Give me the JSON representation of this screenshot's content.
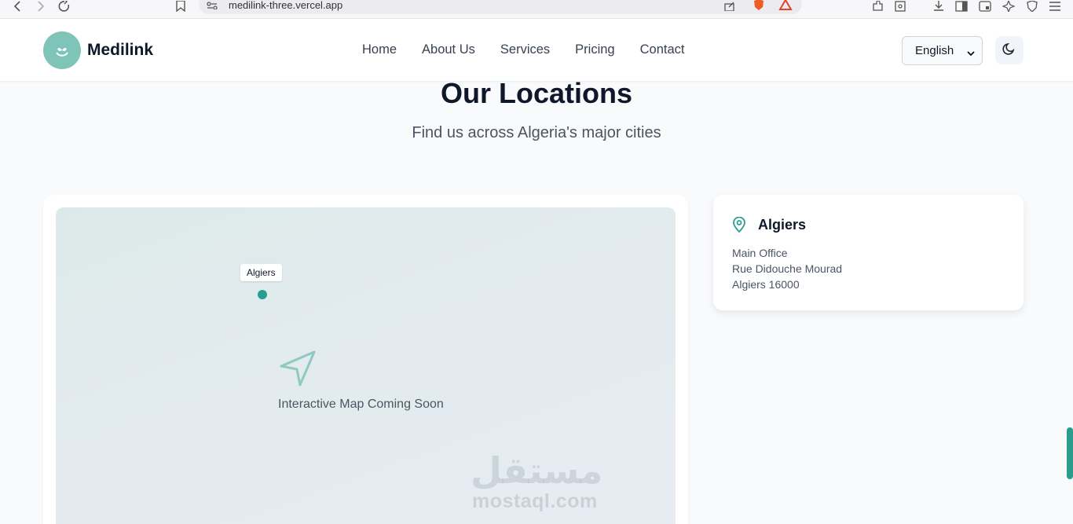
{
  "browser": {
    "url": "medilink-three.vercel.app"
  },
  "header": {
    "brand": "Medilink",
    "nav": [
      "Home",
      "About Us",
      "Services",
      "Pricing",
      "Contact"
    ],
    "language": "English"
  },
  "section": {
    "title": "Our Locations",
    "subtitle": "Find us across Algeria's major cities"
  },
  "map": {
    "pin_label": "Algiers",
    "caption": "Interactive Map Coming Soon"
  },
  "location": {
    "name": "Algiers",
    "lines": [
      "Main Office",
      "Rue Didouche Mourad",
      "Algiers 16000"
    ]
  },
  "watermark": {
    "arabic": "مستقل",
    "latin": "mostaql.com"
  },
  "colors": {
    "accent": "#2a9d8f",
    "logo_bg": "#7ec4b8"
  }
}
